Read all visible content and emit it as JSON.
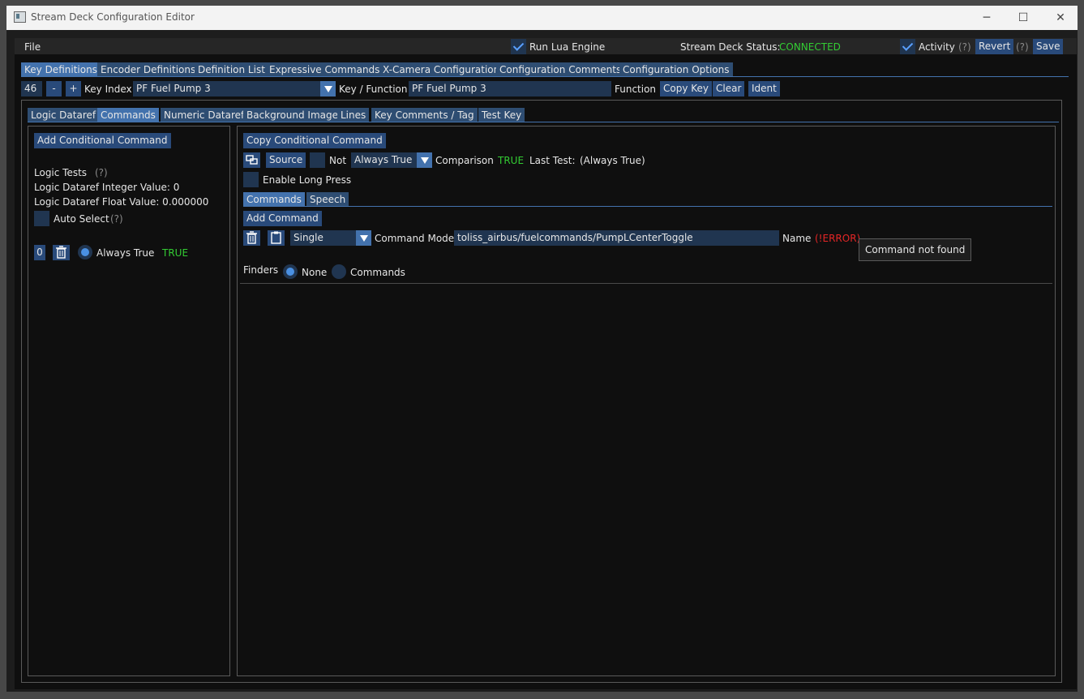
{
  "window": {
    "title": "Stream Deck Configuration Editor",
    "minimize_glyph": "─",
    "maximize_glyph": "☐",
    "close_glyph": "✕"
  },
  "menubar": {
    "file": "File",
    "run_lua_label": "Run Lua Engine",
    "status_label": "Stream Deck Status:",
    "status_value": "CONNECTED",
    "activity_label": "Activity",
    "help_mark": "(?)",
    "revert": "Revert",
    "save": "Save"
  },
  "main_tabs": [
    "Key Definitions",
    "Encoder Definitions",
    "Definition List",
    "Expressive Commands",
    "X-Camera Configuration",
    "Configuration Comments",
    "Configuration Options"
  ],
  "key_row": {
    "number": "46",
    "minus": "-",
    "plus": "+",
    "key_index_label": "Key Index",
    "key_select_value": "PF Fuel Pump 3",
    "key_function_label": "Key / Function",
    "function_value": "PF Fuel Pump 3",
    "function_label": "Function",
    "copy_key": "Copy Key",
    "clear": "Clear",
    "ident": "Ident"
  },
  "sub_tabs": [
    "Logic Dataref",
    "Commands",
    "Numeric Dataref",
    "Background Image",
    "Lines",
    "Key Comments / Tag",
    "Test Key"
  ],
  "left_panel": {
    "add_conditional": "Add Conditional Command",
    "logic_tests": "Logic Tests",
    "help_mark": "(?)",
    "int_value": "Logic Dataref Integer Value: 0",
    "float_value": "Logic Dataref Float Value: 0.000000",
    "auto_select": "Auto Select",
    "row_index": "0",
    "always_true": "Always True",
    "true_text": "TRUE"
  },
  "right_panel": {
    "copy_conditional": "Copy Conditional Command",
    "source": "Source",
    "not_label": "Not",
    "comparison_select": "Always True",
    "comparison_label": "Comparison",
    "comparison_value": "TRUE",
    "last_test_label": "Last Test:",
    "last_test_value": "(Always True)",
    "enable_long_press": "Enable Long Press",
    "inner_tabs": [
      "Commands",
      "Speech"
    ],
    "add_command": "Add Command",
    "mode_select": "Single",
    "command_mode_label": "Command Mode",
    "command_value": "toliss_airbus/fuelcommands/PumpLCenterToggle",
    "name_label": "Name",
    "name_error": "(!ERROR)",
    "tooltip": "Command not found",
    "finders_label": "Finders",
    "finder_none": "None",
    "finder_commands": "Commands"
  },
  "colors": {
    "accent": "#4372ad",
    "button": "#294a7a",
    "ok": "#33cc33",
    "error": "#e62626"
  },
  "icons": [
    "app-icon",
    "checkmark-icon",
    "dropdown-arrow-icon",
    "trash-icon",
    "clipboard-icon",
    "link-icon",
    "radio-icon"
  ]
}
